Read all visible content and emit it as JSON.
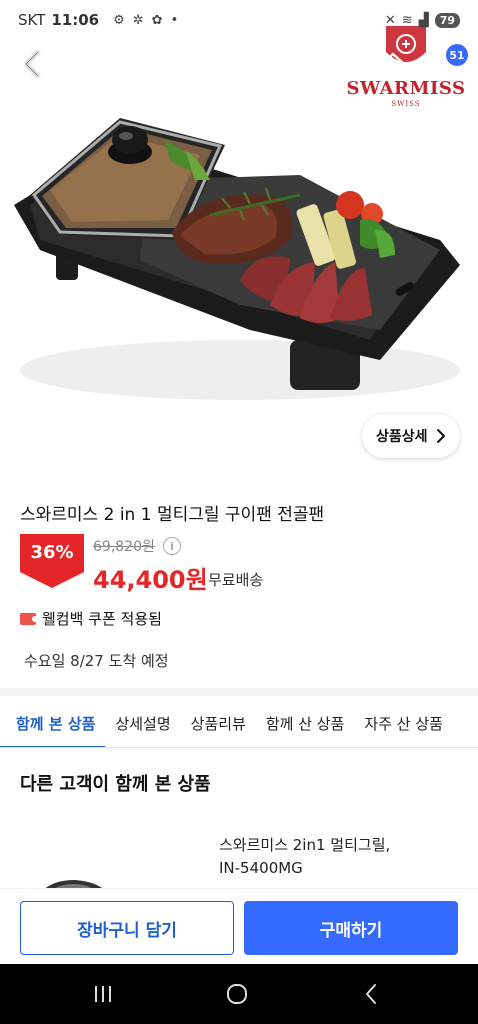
{
  "status_bar": {
    "carrier": "SKT",
    "time": "11:06",
    "battery": "79"
  },
  "nav": {
    "cart_count": "51"
  },
  "brand": {
    "name": "SWARMISS",
    "sub": "SWISS"
  },
  "hero": {
    "detail_button": "상품상세"
  },
  "product": {
    "title": "스와르미스 2 in 1 멀티그릴 구이팬 전골팬",
    "discount": "36%",
    "original_price": "69,820원",
    "sale_price": "44,400원",
    "shipping": "무료배송",
    "coupon": "웰컴백 쿠폰 적용됨",
    "delivery": "수요일 8/27 도착 예정"
  },
  "tabs": [
    {
      "label": "함께 본 상품"
    },
    {
      "label": "상세설명"
    },
    {
      "label": "상품리뷰"
    },
    {
      "label": "함께 산 상품"
    },
    {
      "label": "자주 산 상품"
    }
  ],
  "section": {
    "title": "다른 고객이 함께 본 상품"
  },
  "recommendation": {
    "name_line1": "스와르미스 2in1 멀티그릴,",
    "name_line2": "IN-5400MG"
  },
  "actions": {
    "cart_label": "장바구니 담기",
    "buy_label": "구매하기"
  },
  "colors": {
    "accent": "#346aff",
    "price_red": "#e52528",
    "brand_red": "#c8202a"
  }
}
